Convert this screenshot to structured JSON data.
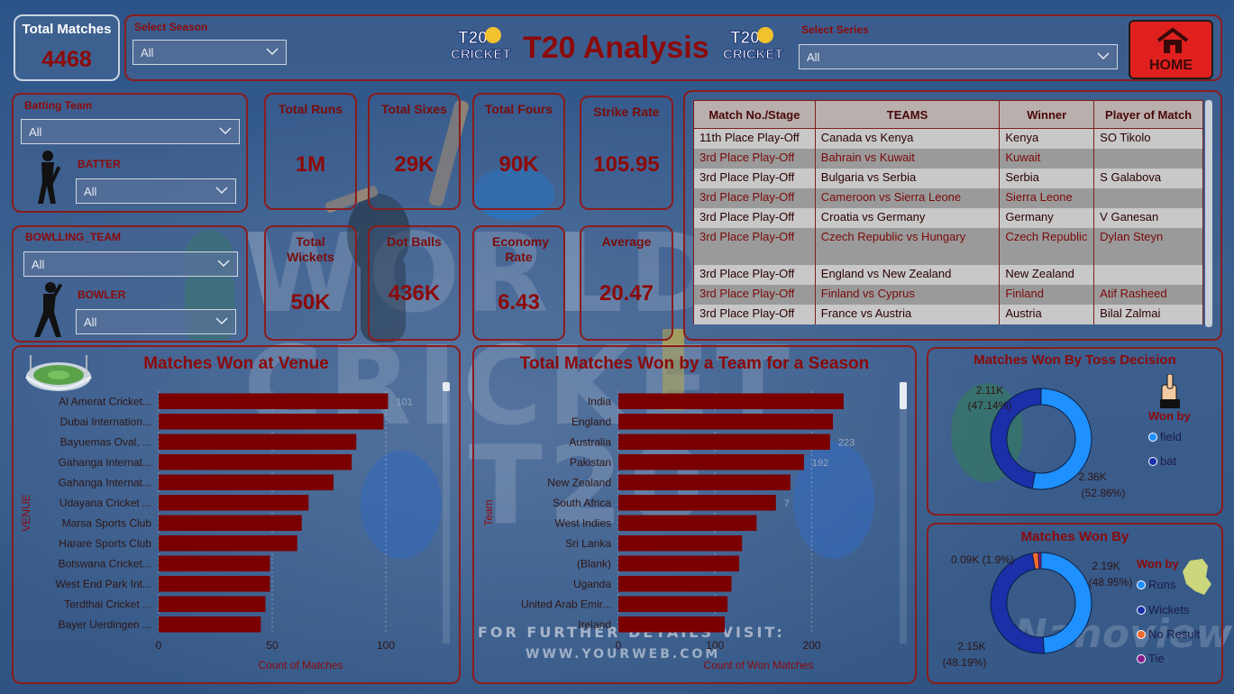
{
  "header": {
    "title": "T20 Analysis",
    "logo_text_top": "T20",
    "logo_text_bottom": "CRICKET",
    "total_matches_label": "Total Matches",
    "total_matches_value": "4468",
    "season_label": "Select Season",
    "season_value": "All",
    "series_label": "Select Series",
    "series_value": "All",
    "home_label": "HOME"
  },
  "filters": {
    "batting_team_label": "Batting Team",
    "batting_team_value": "All",
    "batter_label": "BATTER",
    "batter_value": "All",
    "bowling_team_label": "BOWLLING_TEAM",
    "bowling_team_value": "All",
    "bowler_label": "BOWLER",
    "bowler_value": "All"
  },
  "kpis": [
    {
      "label": "Total Runs",
      "value": "1M"
    },
    {
      "label": "Total Sixes",
      "value": "29K"
    },
    {
      "label": "Total Fours",
      "value": "90K"
    },
    {
      "label": "Strike Rate",
      "value": "105.95"
    },
    {
      "label": "Total Wickets",
      "value": "50K"
    },
    {
      "label": "Dot Balls",
      "value": "436K"
    },
    {
      "label": "Economy Rate",
      "value": "6.43"
    },
    {
      "label": "Average",
      "value": "20.47"
    }
  ],
  "match_table": {
    "columns": [
      "Match No./Stage",
      "TEAMS",
      "Winner",
      "Player of Match"
    ],
    "rows": [
      [
        "11th Place Play-Off",
        "Canada vs Kenya",
        "Kenya",
        "SO Tikolo"
      ],
      [
        "3rd Place Play-Off",
        "Bahrain vs Kuwait",
        "Kuwait",
        ""
      ],
      [
        "3rd Place Play-Off",
        "Bulgaria vs Serbia",
        "Serbia",
        "S Galabova"
      ],
      [
        "3rd Place Play-Off",
        "Cameroon vs Sierra Leone",
        "Sierra Leone",
        ""
      ],
      [
        "3rd Place Play-Off",
        "Croatia vs Germany",
        "Germany",
        "V Ganesan"
      ],
      [
        "3rd Place Play-Off",
        "Czech Republic vs Hungary",
        "Czech Republic",
        "Dylan Steyn"
      ],
      [
        "3rd Place Play-Off",
        "England vs New Zealand",
        "New Zealand",
        ""
      ],
      [
        "3rd Place Play-Off",
        "Finland vs Cyprus",
        "Finland",
        "Atif Rasheed"
      ],
      [
        "3rd Place Play-Off",
        "France vs Austria",
        "Austria",
        "Bilal Zalmai"
      ]
    ]
  },
  "background_text": {
    "promo_line1": "FOR FURTHER DETAILS VISIT:",
    "promo_line2": "WWW.YOURWEB.COM",
    "watermark": "Nanoview"
  },
  "venue_chart": {
    "title": "Matches Won at Venue",
    "xlabel": "Count of Matches",
    "ylabel": "VENUE",
    "xticks": [
      "0",
      "50",
      "100"
    ],
    "xlim": [
      0,
      125
    ],
    "categories": [
      "Al Amerat Cricket...",
      "Dubai Internation...",
      "Bayuemas Oval, ...",
      "Gahanga Internat...",
      "Gahanga Internat...",
      "Udayana Cricket ...",
      "Marsa Sports Club",
      "Harare Sports Club",
      "Botswana Cricket...",
      "West End Park Int...",
      "Terdthai Cricket ...",
      "Bayer Uerdingen ..."
    ],
    "values": [
      101,
      99,
      87,
      85,
      77,
      66,
      63,
      61,
      49,
      49,
      47,
      45
    ],
    "labels": [
      "101",
      "",
      "",
      "",
      "",
      "",
      "",
      "",
      "",
      "",
      "",
      ""
    ]
  },
  "team_chart": {
    "title": "Total Matches Won by a Team for a Season",
    "xlabel": "Count of Won Matches",
    "ylabel": "Team",
    "xticks": [
      "0",
      "100",
      "200"
    ],
    "xlim": [
      0,
      290
    ],
    "categories": [
      "India",
      "England",
      "Australia",
      "Pakistan",
      "New Zealand",
      "South Africa",
      "West Indies",
      "Sri Lanka",
      "(Blank)",
      "Uganda",
      "United Arab Emir...",
      "Ireland"
    ],
    "values": [
      233,
      222,
      219,
      192,
      178,
      163,
      143,
      128,
      125,
      117,
      113,
      110
    ],
    "labels": [
      "",
      "",
      "223",
      "192",
      "",
      "7",
      "",
      "",
      "",
      "",
      "",
      ""
    ]
  },
  "chart_data": [
    {
      "type": "bar",
      "title": "Matches Won at Venue",
      "xlabel": "Count of Matches",
      "ylabel": "VENUE",
      "categories": [
        "Al Amerat Cricket...",
        "Dubai Internation...",
        "Bayuemas Oval, ...",
        "Gahanga Internat...",
        "Gahanga Internat...",
        "Udayana Cricket ...",
        "Marsa Sports Club",
        "Harare Sports Club",
        "Botswana Cricket...",
        "West End Park Int...",
        "Terdthai Cricket ...",
        "Bayer Uerdingen ..."
      ],
      "values": [
        101,
        99,
        87,
        85,
        77,
        66,
        63,
        61,
        49,
        49,
        47,
        45
      ]
    },
    {
      "type": "bar",
      "title": "Total Matches Won by a Team for a Season",
      "xlabel": "Count of Won Matches",
      "ylabel": "Team",
      "categories": [
        "India",
        "England",
        "Australia",
        "Pakistan",
        "New Zealand",
        "South Africa",
        "West Indies",
        "Sri Lanka",
        "(Blank)",
        "Uganda",
        "United Arab Emir...",
        "Ireland"
      ],
      "values": [
        233,
        222,
        219,
        192,
        178,
        163,
        143,
        128,
        125,
        117,
        113,
        110
      ]
    },
    {
      "type": "pie",
      "title": "Matches Won By Toss Decision",
      "legend_title": "Won by",
      "slices": [
        {
          "name": "field",
          "value": 2.36,
          "label": "2.36K",
          "pct": "(52.86%)",
          "color": "#1e90ff"
        },
        {
          "name": "bat",
          "value": 2.11,
          "label": "2.11K",
          "pct": "(47.14%)",
          "color": "#1a2fa8"
        }
      ]
    },
    {
      "type": "pie",
      "title": "Matches Won By",
      "legend_title": "Won by",
      "slices": [
        {
          "name": "Runs",
          "value": 2.19,
          "label": "2.19K",
          "pct": "(48.95%)",
          "color": "#1e90ff"
        },
        {
          "name": "Wickets",
          "value": 2.15,
          "label": "2.15K",
          "pct": "(48.19%)",
          "color": "#1a2fa8"
        },
        {
          "name": "No Result",
          "value": 0.085,
          "label": "0.09K (1.9%)",
          "pct": "",
          "color": "#f26a2e"
        },
        {
          "name": "Tie",
          "value": 0.04,
          "label": "",
          "pct": "",
          "color": "#8b1a8b"
        }
      ]
    }
  ],
  "toss_chart": {
    "title": "Matches Won By Toss Decision",
    "legend_title": "Won by",
    "field_label": "field",
    "field_value": "2.36K",
    "field_pct": "(52.86%)",
    "bat_label": "bat",
    "bat_value": "2.11K",
    "bat_pct": "(47.14%)"
  },
  "wonby_chart": {
    "title": "Matches Won By",
    "legend_title": "Won by",
    "legend": [
      "Runs",
      "Wickets",
      "No Result",
      "Tie"
    ],
    "runs_value": "2.19K",
    "runs_pct": "(48.95%)",
    "wickets_value": "2.15K",
    "wickets_pct": "(48.19%)",
    "noresult_label": "0.09K (1.9%)"
  },
  "colors": {
    "accent": "#8b0a0a",
    "bar": "#7a0000",
    "field": "#1e90ff",
    "bat": "#1a2fa8",
    "noresult": "#f26a2e",
    "tie": "#8b1a8b",
    "home_bg": "#e0201e"
  }
}
